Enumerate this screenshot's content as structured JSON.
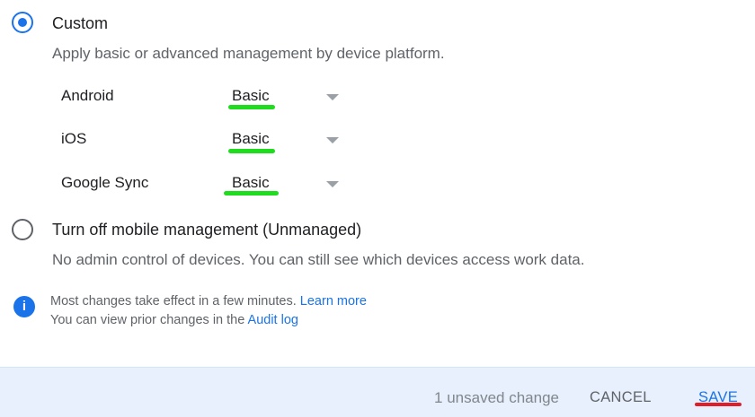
{
  "custom_option": {
    "selected": true,
    "title": "Custom",
    "description": "Apply basic or advanced management by device platform."
  },
  "platforms": [
    {
      "name": "Android",
      "value": "Basic"
    },
    {
      "name": "iOS",
      "value": "Basic"
    },
    {
      "name": "Google Sync",
      "value": "Basic"
    }
  ],
  "unmanaged_option": {
    "selected": false,
    "title": "Turn off mobile management (Unmanaged)",
    "description": "No admin control of devices. You can still see which devices access work data."
  },
  "info": {
    "icon": "info-icon",
    "line1_text": "Most changes take effect in a few minutes.",
    "line1_link": "Learn more",
    "line2_text": "You can view prior changes in the",
    "line2_link": "Audit log"
  },
  "footer": {
    "unsaved_text": "1 unsaved change",
    "cancel_label": "CANCEL",
    "save_label": "SAVE"
  },
  "colors": {
    "accent": "#1a73e8",
    "annotation_green": "#1fdc1f",
    "annotation_red": "#e11d2a",
    "footer_bg": "#e8f0fe"
  }
}
